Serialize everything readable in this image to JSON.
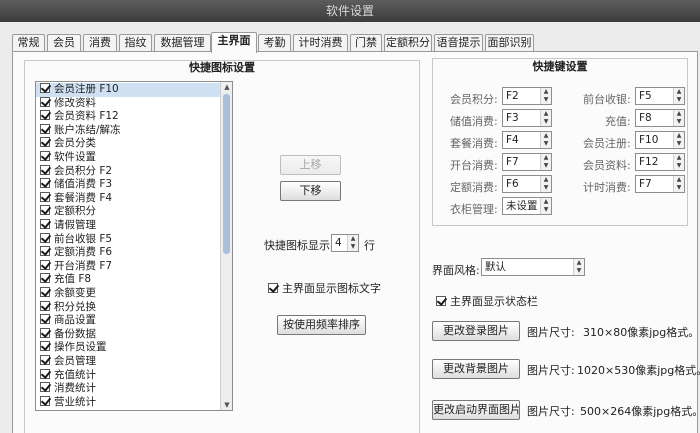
{
  "window": {
    "title": "软件设置"
  },
  "tabs": [
    {
      "label": "常规"
    },
    {
      "label": "会员"
    },
    {
      "label": "消费"
    },
    {
      "label": "指纹"
    },
    {
      "label": "数据管理"
    },
    {
      "label": "主界面"
    },
    {
      "label": "考勤"
    },
    {
      "label": "计时消费"
    },
    {
      "label": "门禁"
    },
    {
      "label": "定额积分"
    },
    {
      "label": "语音提示"
    },
    {
      "label": "面部识别"
    }
  ],
  "active_tab": "主界面",
  "shortcut_icons": {
    "title": "快捷图标设置",
    "items": [
      {
        "label": "会员注册  F10",
        "checked": true,
        "selected": true
      },
      {
        "label": "修改资料",
        "checked": true
      },
      {
        "label": "会员资料  F12",
        "checked": true
      },
      {
        "label": "账户冻结/解冻",
        "checked": true
      },
      {
        "label": "会员分类",
        "checked": true
      },
      {
        "label": "软件设置",
        "checked": true
      },
      {
        "label": "会员积分  F2",
        "checked": true
      },
      {
        "label": "储值消费  F3",
        "checked": true
      },
      {
        "label": "套餐消费  F4",
        "checked": true
      },
      {
        "label": "定额积分",
        "checked": true
      },
      {
        "label": "请假管理",
        "checked": true
      },
      {
        "label": "前台收银  F5",
        "checked": true
      },
      {
        "label": "定额消费  F6",
        "checked": true
      },
      {
        "label": "开台消费  F7",
        "checked": true
      },
      {
        "label": "充值  F8",
        "checked": true
      },
      {
        "label": "余额变更",
        "checked": true
      },
      {
        "label": "积分兑换",
        "checked": true
      },
      {
        "label": "商品设置",
        "checked": true
      },
      {
        "label": "备份数据",
        "checked": true
      },
      {
        "label": "操作员设置",
        "checked": true
      },
      {
        "label": "会员管理",
        "checked": true
      },
      {
        "label": "充值统计",
        "checked": true
      },
      {
        "label": "消费统计",
        "checked": true
      },
      {
        "label": "营业统计",
        "checked": true
      }
    ],
    "move_up_label": "上移",
    "move_down_label": "下移",
    "rows_label": "快捷图标显示:",
    "rows_value": "4",
    "rows_unit": "行",
    "show_text_label": "主界面显示图标文字",
    "show_text_checked": true,
    "sort_button_label": "按使用频率排序"
  },
  "hotkeys": {
    "title": "快捷键设置",
    "left": [
      {
        "label": "会员积分:",
        "value": "F2"
      },
      {
        "label": "储值消费:",
        "value": "F3"
      },
      {
        "label": "套餐消费:",
        "value": "F4"
      },
      {
        "label": "开台消费:",
        "value": "F7"
      },
      {
        "label": "定额消费:",
        "value": "F6"
      },
      {
        "label": "衣柜管理:",
        "value": "未设置"
      }
    ],
    "right": [
      {
        "label": "前台收银:",
        "value": "F5"
      },
      {
        "label": "充值:",
        "value": "F8"
      },
      {
        "label": "会员注册:",
        "value": "F10"
      },
      {
        "label": "会员资料:",
        "value": "F12"
      },
      {
        "label": "计时消费:",
        "value": "F7"
      }
    ]
  },
  "appearance": {
    "style_label": "界面风格:",
    "style_value": "默认",
    "show_status_label": "主界面显示状态栏",
    "show_status_checked": true,
    "images": [
      {
        "button": "更改登录图片",
        "size_label": "图片尺寸:",
        "size_value": "310×80像素jpg格式。"
      },
      {
        "button": "更改背景图片",
        "size_label": "图片尺寸:",
        "size_value": "1020×530像素jpg格式。"
      },
      {
        "button": "更改启动界面图片",
        "size_label": "图片尺寸:",
        "size_value": "500×264像素jpg格式。"
      }
    ]
  }
}
